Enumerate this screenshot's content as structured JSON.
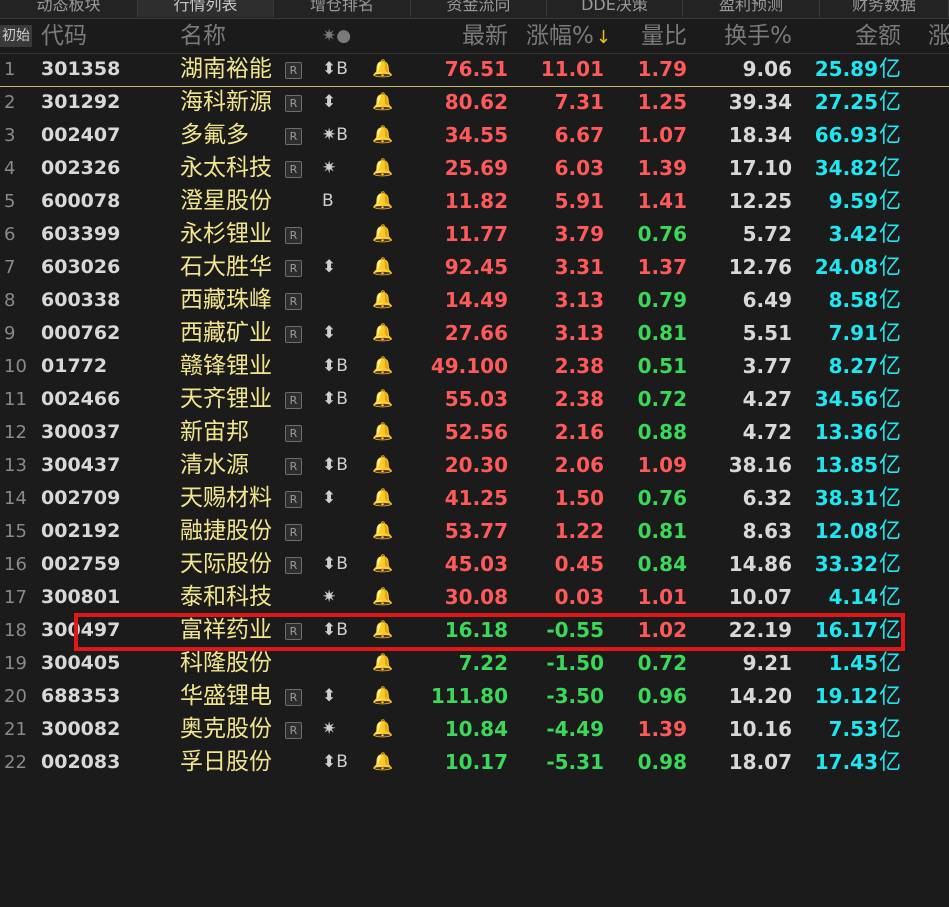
{
  "tabs": [
    "动态板块",
    "行情列表",
    "增仓排名",
    "资金流向",
    "DDE决策",
    "盈利预测",
    "财务数据"
  ],
  "active_tab": 1,
  "header": {
    "init": "初始",
    "code": "代码",
    "name": "名称",
    "flags": "✷●",
    "price": "最新",
    "change": "涨幅%",
    "sort_arrow": "↓",
    "volume_ratio": "量比",
    "turnover": "换手%",
    "amount": "金额",
    "extra": "涨"
  },
  "amount_unit": "亿",
  "badge_r": "R",
  "bell_icon": "🔔",
  "colors": {
    "up": "#ff5a5a",
    "down": "#3cd85a",
    "amount": "#1fe6f0",
    "name": "#f2e68c",
    "highlight": "#e01818"
  },
  "highlight_row": 17,
  "rows": [
    {
      "idx": "1",
      "code": "301358",
      "name": "湖南裕能",
      "r": true,
      "flag": "⬍B",
      "price": "76.51",
      "change": "11.01",
      "ratio": "1.79",
      "turnover": "9.06",
      "amount": "25.89",
      "price_dir": "up",
      "change_dir": "up",
      "ratio_dir": "up"
    },
    {
      "idx": "2",
      "code": "301292",
      "name": "海科新源",
      "r": true,
      "flag": "⬍",
      "price": "80.62",
      "change": "7.31",
      "ratio": "1.25",
      "turnover": "39.34",
      "amount": "27.25",
      "price_dir": "up",
      "change_dir": "up",
      "ratio_dir": "up"
    },
    {
      "idx": "3",
      "code": "002407",
      "name": "多氟多",
      "r": true,
      "flag": "✷B",
      "price": "34.55",
      "change": "6.67",
      "ratio": "1.07",
      "turnover": "18.34",
      "amount": "66.93",
      "price_dir": "up",
      "change_dir": "up",
      "ratio_dir": "up"
    },
    {
      "idx": "4",
      "code": "002326",
      "name": "永太科技",
      "r": true,
      "flag": "✷",
      "price": "25.69",
      "change": "6.03",
      "ratio": "1.39",
      "turnover": "17.10",
      "amount": "34.82",
      "price_dir": "up",
      "change_dir": "up",
      "ratio_dir": "up"
    },
    {
      "idx": "5",
      "code": "600078",
      "name": "澄星股份",
      "r": false,
      "flag": "  B",
      "price": "11.82",
      "change": "5.91",
      "ratio": "1.41",
      "turnover": "12.25",
      "amount": "9.59",
      "price_dir": "up",
      "change_dir": "up",
      "ratio_dir": "up"
    },
    {
      "idx": "6",
      "code": "603399",
      "name": "永杉锂业",
      "r": true,
      "flag": "",
      "price": "11.77",
      "change": "3.79",
      "ratio": "0.76",
      "turnover": "5.72",
      "amount": "3.42",
      "price_dir": "up",
      "change_dir": "up",
      "ratio_dir": "down"
    },
    {
      "idx": "7",
      "code": "603026",
      "name": "石大胜华",
      "r": true,
      "flag": "⬍",
      "price": "92.45",
      "change": "3.31",
      "ratio": "1.37",
      "turnover": "12.76",
      "amount": "24.08",
      "price_dir": "up",
      "change_dir": "up",
      "ratio_dir": "up"
    },
    {
      "idx": "8",
      "code": "600338",
      "name": "西藏珠峰",
      "r": true,
      "flag": "",
      "price": "14.49",
      "change": "3.13",
      "ratio": "0.79",
      "turnover": "6.49",
      "amount": "8.58",
      "price_dir": "up",
      "change_dir": "up",
      "ratio_dir": "down"
    },
    {
      "idx": "9",
      "code": "000762",
      "name": "西藏矿业",
      "r": true,
      "flag": "⬍",
      "price": "27.66",
      "change": "3.13",
      "ratio": "0.81",
      "turnover": "5.51",
      "amount": "7.91",
      "price_dir": "up",
      "change_dir": "up",
      "ratio_dir": "down"
    },
    {
      "idx": "10",
      "code": "01772",
      "name": "赣锋锂业",
      "r": false,
      "flag": "⬍B",
      "price": "49.100",
      "change": "2.38",
      "ratio": "0.51",
      "turnover": "3.77",
      "amount": "8.27",
      "price_dir": "up",
      "change_dir": "up",
      "ratio_dir": "down"
    },
    {
      "idx": "11",
      "code": "002466",
      "name": "天齐锂业",
      "r": true,
      "flag": "⬍B",
      "price": "55.03",
      "change": "2.38",
      "ratio": "0.72",
      "turnover": "4.27",
      "amount": "34.56",
      "price_dir": "up",
      "change_dir": "up",
      "ratio_dir": "down"
    },
    {
      "idx": "12",
      "code": "300037",
      "name": "新宙邦",
      "r": true,
      "flag": "",
      "price": "52.56",
      "change": "2.16",
      "ratio": "0.88",
      "turnover": "4.72",
      "amount": "13.36",
      "price_dir": "up",
      "change_dir": "up",
      "ratio_dir": "down"
    },
    {
      "idx": "13",
      "code": "300437",
      "name": "清水源",
      "r": true,
      "flag": "⬍B",
      "price": "20.30",
      "change": "2.06",
      "ratio": "1.09",
      "turnover": "38.16",
      "amount": "13.85",
      "price_dir": "up",
      "change_dir": "up",
      "ratio_dir": "up"
    },
    {
      "idx": "14",
      "code": "002709",
      "name": "天赐材料",
      "r": true,
      "flag": "⬍",
      "price": "41.25",
      "change": "1.50",
      "ratio": "0.76",
      "turnover": "6.32",
      "amount": "38.31",
      "price_dir": "up",
      "change_dir": "up",
      "ratio_dir": "down"
    },
    {
      "idx": "15",
      "code": "002192",
      "name": "融捷股份",
      "r": true,
      "flag": "",
      "price": "53.77",
      "change": "1.22",
      "ratio": "0.81",
      "turnover": "8.63",
      "amount": "12.08",
      "price_dir": "up",
      "change_dir": "up",
      "ratio_dir": "down"
    },
    {
      "idx": "16",
      "code": "002759",
      "name": "天际股份",
      "r": true,
      "flag": "⬍B",
      "price": "45.03",
      "change": "0.45",
      "ratio": "0.84",
      "turnover": "14.86",
      "amount": "33.32",
      "price_dir": "up",
      "change_dir": "up",
      "ratio_dir": "down"
    },
    {
      "idx": "17",
      "code": "300801",
      "name": "泰和科技",
      "r": false,
      "flag": "✷",
      "price": "30.08",
      "change": "0.03",
      "ratio": "1.01",
      "turnover": "10.07",
      "amount": "4.14",
      "price_dir": "up",
      "change_dir": "up",
      "ratio_dir": "up"
    },
    {
      "idx": "18",
      "code": "300497",
      "name": "富祥药业",
      "r": true,
      "flag": "⬍B",
      "price": "16.18",
      "change": "-0.55",
      "ratio": "1.02",
      "turnover": "22.19",
      "amount": "16.17",
      "price_dir": "down",
      "change_dir": "down",
      "ratio_dir": "up"
    },
    {
      "idx": "19",
      "code": "300405",
      "name": "科隆股份",
      "r": false,
      "flag": "",
      "price": "7.22",
      "change": "-1.50",
      "ratio": "0.72",
      "turnover": "9.21",
      "amount": "1.45",
      "price_dir": "down",
      "change_dir": "down",
      "ratio_dir": "down"
    },
    {
      "idx": "20",
      "code": "688353",
      "name": "华盛锂电",
      "r": true,
      "flag": "⬍",
      "price": "111.80",
      "change": "-3.50",
      "ratio": "0.96",
      "turnover": "14.20",
      "amount": "19.12",
      "price_dir": "down",
      "change_dir": "down",
      "ratio_dir": "down"
    },
    {
      "idx": "21",
      "code": "300082",
      "name": "奥克股份",
      "r": true,
      "flag": "✷",
      "price": "10.84",
      "change": "-4.49",
      "ratio": "1.39",
      "turnover": "10.16",
      "amount": "7.53",
      "price_dir": "down",
      "change_dir": "down",
      "ratio_dir": "up"
    },
    {
      "idx": "22",
      "code": "002083",
      "name": "孚日股份",
      "r": false,
      "flag": "⬍B",
      "price": "10.17",
      "change": "-5.31",
      "ratio": "0.98",
      "turnover": "18.07",
      "amount": "17.43",
      "price_dir": "down",
      "change_dir": "down",
      "ratio_dir": "down"
    }
  ]
}
